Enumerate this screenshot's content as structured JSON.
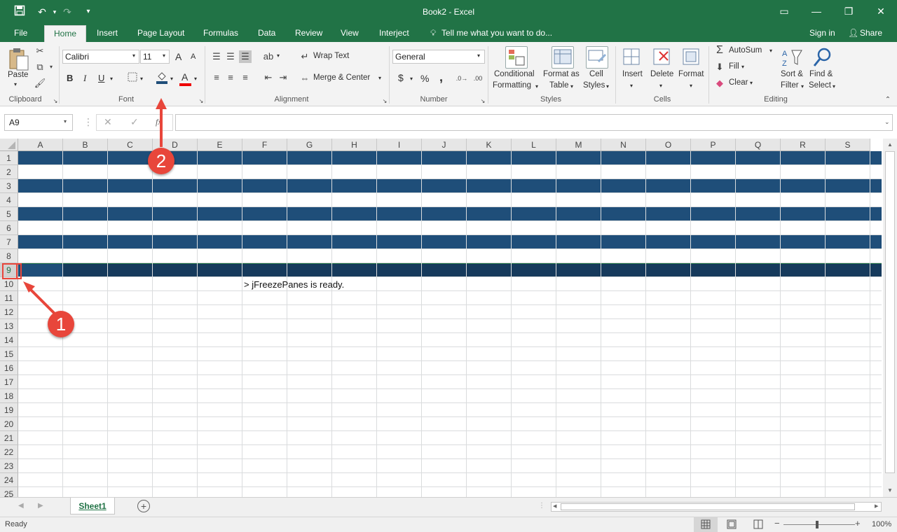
{
  "window": {
    "title": "Book2 - Excel"
  },
  "tabs": [
    "File",
    "Home",
    "Insert",
    "Page Layout",
    "Formulas",
    "Data",
    "Review",
    "View",
    "Interject"
  ],
  "tell_me": "Tell me what you want to do...",
  "sign_in": "Sign in",
  "share": "Share",
  "clipboard": {
    "paste": "Paste",
    "label": "Clipboard"
  },
  "font": {
    "name": "Calibri",
    "size": "11",
    "label": "Font",
    "bold": "B",
    "italic": "I",
    "underline": "U",
    "grow": "A",
    "shrink": "A",
    "color_letter": "A"
  },
  "alignment": {
    "wrap": "Wrap Text",
    "merge": "Merge & Center",
    "label": "Alignment"
  },
  "number": {
    "format": "General",
    "currency": "$",
    "percent": "%",
    "comma": ",",
    "label": "Number"
  },
  "styles": {
    "cond1": "Conditional",
    "cond2": "Formatting",
    "table1": "Format as",
    "table2": "Table",
    "cell1": "Cell",
    "cell2": "Styles",
    "label": "Styles"
  },
  "cells": {
    "insert": "Insert",
    "delete": "Delete",
    "format": "Format",
    "label": "Cells"
  },
  "editing": {
    "autosum": "AutoSum",
    "fill": "Fill",
    "clear": "Clear",
    "sort1": "Sort &",
    "sort2": "Filter",
    "find1": "Find &",
    "find2": "Select",
    "label": "Editing"
  },
  "namebox": "A9",
  "fx": "fx",
  "columns": [
    "A",
    "B",
    "C",
    "D",
    "E",
    "F",
    "G",
    "H",
    "I",
    "J",
    "K",
    "L",
    "M",
    "N",
    "O",
    "P",
    "Q",
    "R",
    "S"
  ],
  "rows": [
    "1",
    "2",
    "3",
    "4",
    "5",
    "6",
    "7",
    "8",
    "9",
    "10",
    "11",
    "12",
    "13",
    "14",
    "15",
    "16",
    "17",
    "18",
    "19",
    "20",
    "21",
    "22",
    "23",
    "24",
    "25"
  ],
  "cell_text": "> jFreezePanes is ready.",
  "sheet_tab": "Sheet1",
  "status": "Ready",
  "zoom": "100%",
  "callouts": [
    "1",
    "2"
  ],
  "colors": {
    "excel_green": "#217346",
    "band_dark": "#1f4e79",
    "band_selected": "#163a5c",
    "callout": "#e8463b"
  }
}
